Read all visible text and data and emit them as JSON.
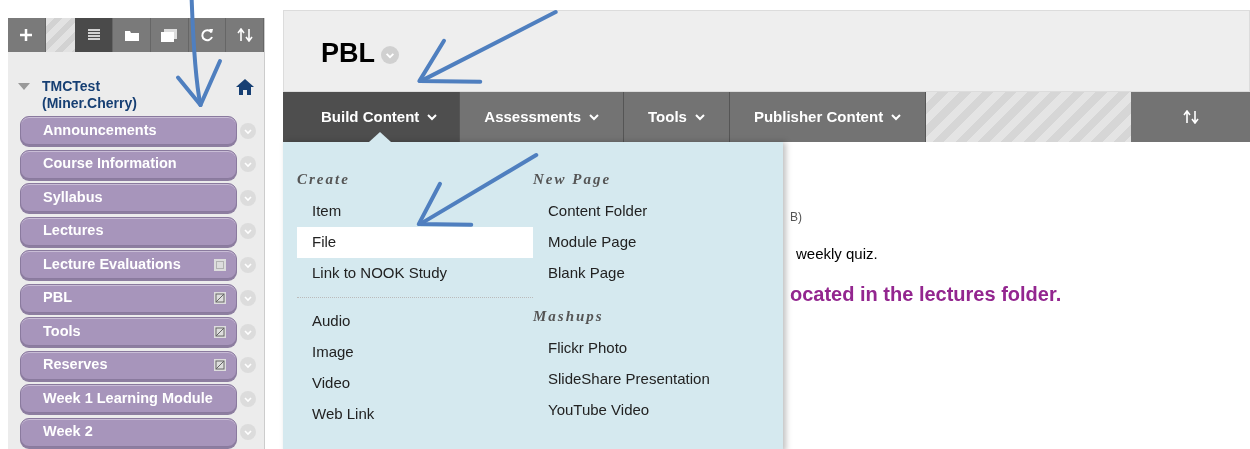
{
  "sidebar": {
    "toolbar": [
      {
        "kind": "add",
        "selected": false
      },
      {
        "kind": "list",
        "selected": true
      },
      {
        "kind": "folder",
        "selected": false
      },
      {
        "kind": "window",
        "selected": false
      },
      {
        "kind": "refresh",
        "selected": false
      },
      {
        "kind": "sort",
        "selected": false
      }
    ],
    "course": {
      "title": "TMCTest (Miner.Cherry)",
      "expanded": true
    },
    "items": [
      {
        "label": "Announcements",
        "kind": "plain"
      },
      {
        "label": "Course Information",
        "kind": "plain"
      },
      {
        "label": "Syllabus",
        "kind": "plain"
      },
      {
        "label": "Lectures",
        "kind": "plain"
      },
      {
        "label": "Lecture Evaluations",
        "kind": "empty"
      },
      {
        "label": "PBL",
        "kind": "hidden"
      },
      {
        "label": "Tools",
        "kind": "hidden"
      },
      {
        "label": "Reserves",
        "kind": "hidden"
      },
      {
        "label": "Week 1 Learning Module",
        "kind": "plain"
      },
      {
        "label": "Week 2",
        "kind": "plain"
      }
    ]
  },
  "page": {
    "title": "PBL",
    "menus": [
      {
        "label": "Build Content",
        "selected": true
      },
      {
        "label": "Assessments",
        "selected": false
      },
      {
        "label": "Tools",
        "selected": false
      },
      {
        "label": "Publisher Content",
        "selected": false
      }
    ],
    "dropdown": {
      "columns": [
        {
          "groups": [
            {
              "heading": "Create",
              "items": [
                {
                  "label": "Item",
                  "selected": false
                },
                {
                  "label": "File",
                  "selected": true
                },
                {
                  "label": "Link to NOOK Study",
                  "selected": false
                }
              ]
            },
            {
              "items": [
                {
                  "label": "Audio",
                  "selected": false
                },
                {
                  "label": "Image",
                  "selected": false
                },
                {
                  "label": "Video",
                  "selected": false
                },
                {
                  "label": "Web Link",
                  "selected": false
                }
              ]
            }
          ]
        },
        {
          "groups": [
            {
              "heading": "New Page",
              "items": [
                {
                  "label": "Content Folder",
                  "selected": false
                },
                {
                  "label": "Module Page",
                  "selected": false
                },
                {
                  "label": "Blank Page",
                  "selected": false
                }
              ]
            },
            {
              "heading": "Mashups",
              "items": [
                {
                  "label": "Flickr Photo",
                  "selected": false
                },
                {
                  "label": "SlideShare Presentation",
                  "selected": false
                },
                {
                  "label": "YouTube Video",
                  "selected": false
                }
              ]
            }
          ]
        }
      ]
    },
    "content": [
      {
        "kind": "note",
        "text": "B)"
      },
      {
        "kind": "text",
        "text": "weekly quiz."
      },
      {
        "kind": "highlight",
        "text": "ocated in the lectures folder."
      }
    ]
  }
}
